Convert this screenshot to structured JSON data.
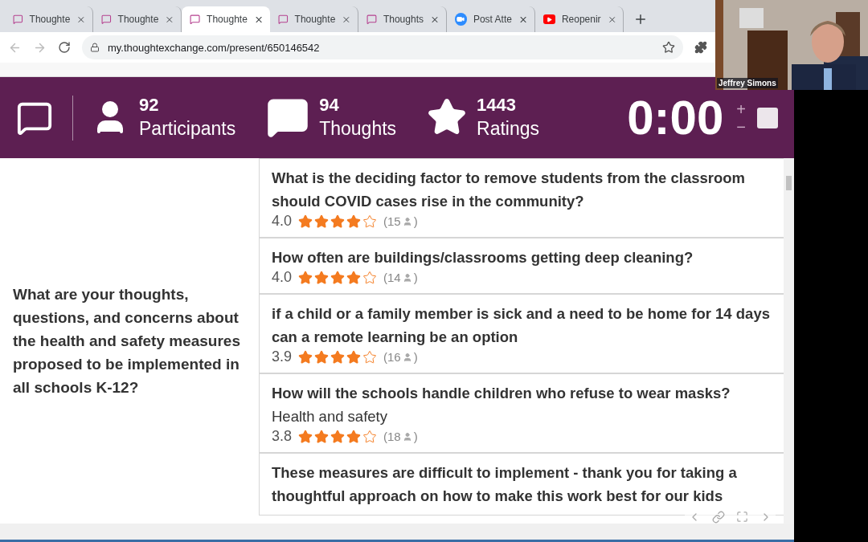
{
  "browser": {
    "tabs": [
      {
        "title": "Thoughte",
        "kind": "thoughtexchange",
        "selected": false
      },
      {
        "title": "Thoughte",
        "kind": "thoughtexchange",
        "selected": false
      },
      {
        "title": "Thoughte",
        "kind": "thoughtexchange",
        "selected": true
      },
      {
        "title": "Thoughte",
        "kind": "thoughtexchange",
        "selected": false
      },
      {
        "title": "Thoughts",
        "kind": "thoughtexchange",
        "selected": false
      },
      {
        "title": "Post Atte",
        "kind": "zoom",
        "selected": false
      },
      {
        "title": "Reopenir",
        "kind": "youtube",
        "selected": false
      }
    ],
    "url": "my.thoughtexchange.com/present/650146542"
  },
  "header": {
    "stats": [
      {
        "kind": "participants",
        "value": "92",
        "label": "Participants"
      },
      {
        "kind": "thoughts",
        "value": "94",
        "label": "Thoughts"
      },
      {
        "kind": "ratings",
        "value": "1443",
        "label": "Ratings"
      }
    ],
    "timer": "0:00",
    "plus": "+",
    "minus": "−"
  },
  "question": "What are your thoughts, questions, and concerns about the health and safety measures proposed to be implemented in all schools K-12?",
  "thoughts": [
    {
      "text": "What is the deciding factor to remove students from the classroom should COVID cases rise in the community?",
      "rating": "4.0",
      "stars": 4,
      "count": "(15",
      "close": ")"
    },
    {
      "text": "How often are buildings/classrooms getting deep cleaning?",
      "rating": "4.0",
      "stars": 4,
      "count": "(14",
      "close": ")"
    },
    {
      "text": "if a child or a family member is sick and a need to be home for 14 days can a remote learning be an option",
      "rating": "3.9",
      "stars": 4,
      "count": "(16",
      "close": ")"
    },
    {
      "text": "How will the schools handle children who refuse to wear masks?",
      "category": "Health and safety",
      "rating": "3.8",
      "stars": 4,
      "count": "(18",
      "close": ")"
    },
    {
      "text": "These measures are difficult to implement - thank you for taking a thoughtful approach on how to make this work best for our kids"
    }
  ],
  "video": {
    "name": "Jeffrey Simons"
  }
}
